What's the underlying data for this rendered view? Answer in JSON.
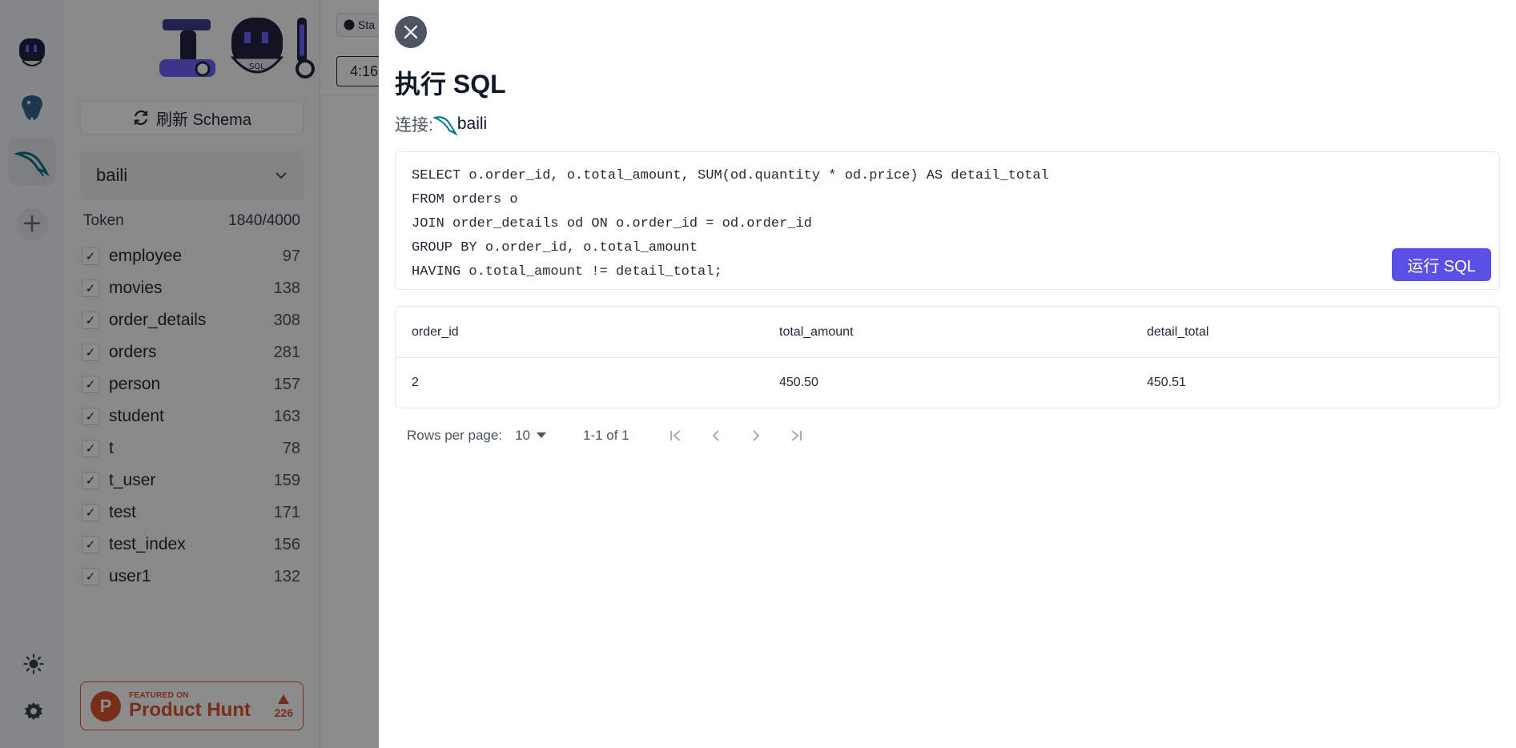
{
  "sidebar": {
    "refresh_label": "刷新 Schema",
    "connection": "baili",
    "token_label": "Token",
    "token_value": "1840/4000",
    "tables": [
      {
        "name": "employee",
        "count": "97"
      },
      {
        "name": "movies",
        "count": "138"
      },
      {
        "name": "order_details",
        "count": "308"
      },
      {
        "name": "orders",
        "count": "281"
      },
      {
        "name": "person",
        "count": "157"
      },
      {
        "name": "student",
        "count": "163"
      },
      {
        "name": "t",
        "count": "78"
      },
      {
        "name": "t_user",
        "count": "159"
      },
      {
        "name": "test",
        "count": "171"
      },
      {
        "name": "test_index",
        "count": "156"
      },
      {
        "name": "user1",
        "count": "132"
      }
    ],
    "product_hunt": {
      "featured": "FEATURED ON",
      "name": "Product Hunt",
      "votes": "226"
    }
  },
  "main": {
    "github_label": "Sta",
    "time_value": "4:16"
  },
  "drawer": {
    "title": "执行 SQL",
    "connection_label": "连接:",
    "connection_name": "baili",
    "sql_lines": [
      "SELECT o.order_id, o.total_amount, SUM(od.quantity * od.price) AS detail_total",
      "FROM orders o",
      "JOIN order_details od ON o.order_id = od.order_id",
      "GROUP BY o.order_id, o.total_amount",
      "HAVING o.total_amount != detail_total;"
    ],
    "run_label": "运行 SQL",
    "result": {
      "columns": [
        "order_id",
        "total_amount",
        "detail_total"
      ],
      "rows": [
        [
          "2",
          "450.50",
          "450.51"
        ]
      ]
    },
    "pagination": {
      "rows_per_page_label": "Rows per page:",
      "rows_per_page_value": "10",
      "range": "1-1 of 1"
    }
  },
  "colors": {
    "accent": "#5b50e6",
    "overlay": "#000000",
    "product_hunt": "#da552f"
  }
}
